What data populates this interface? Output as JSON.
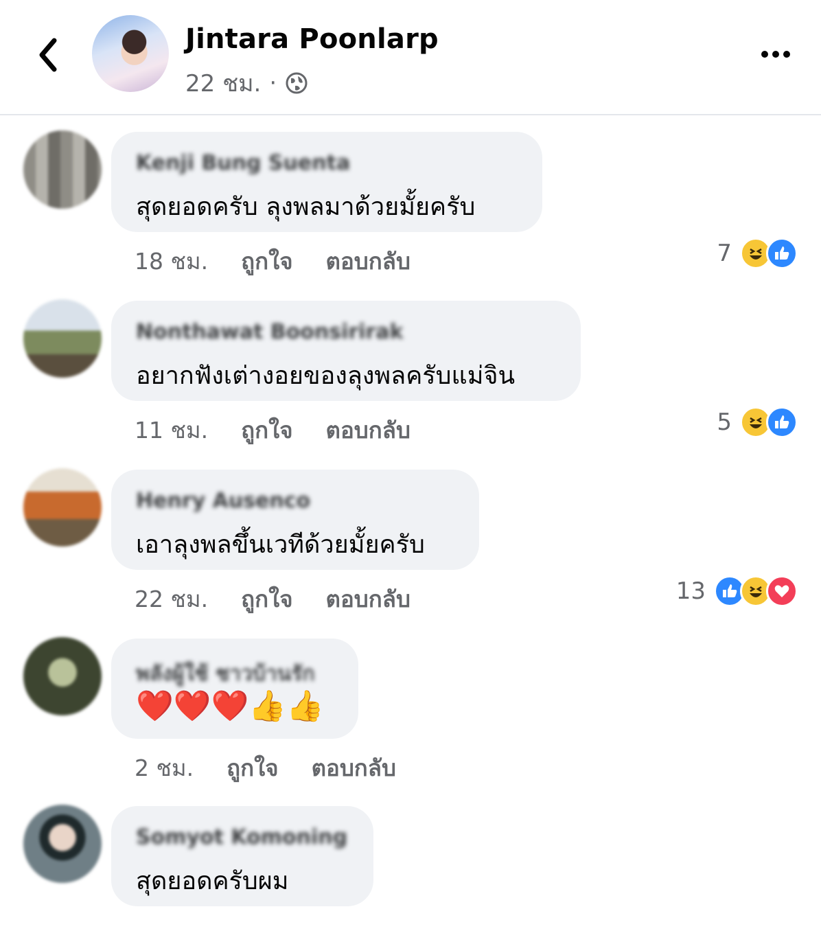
{
  "header": {
    "name": "Jintara Poonlarp",
    "time": "22 ชม.",
    "separator": "·"
  },
  "comments": [
    {
      "author": "Kenji Bung Suenta",
      "text": "สุดยอดครับ ลุงพลมาด้วยมั้ยครับ",
      "time": "18 ชม.",
      "like_label": "ถูกใจ",
      "reply_label": "ตอบกลับ",
      "reaction_count": "7",
      "reactions": [
        "haha",
        "like"
      ]
    },
    {
      "author": "Nonthawat Boonsirirak",
      "text": "อยากฟังเต่างอยของลุงพลครับแม่จิน",
      "time": "11 ชม.",
      "like_label": "ถูกใจ",
      "reply_label": "ตอบกลับ",
      "reaction_count": "5",
      "reactions": [
        "haha",
        "like"
      ]
    },
    {
      "author": "Henry Ausenco",
      "text": "เอาลุงพลขึ้นเวทีด้วยมั้ยครับ",
      "time": "22 ชม.",
      "like_label": "ถูกใจ",
      "reply_label": "ตอบกลับ",
      "reaction_count": "13",
      "reactions": [
        "like",
        "haha",
        "love"
      ]
    },
    {
      "author": "พลังผู้ใช้ ชาวบ้านรัก",
      "text": "❤️❤️❤️👍👍",
      "time": "2 ชม.",
      "like_label": "ถูกใจ",
      "reply_label": "ตอบกลับ",
      "reaction_count": "",
      "reactions": []
    },
    {
      "author": "Somyot Komoning",
      "text": "สุดยอดครับผม",
      "time": "",
      "like_label": "",
      "reply_label": "",
      "reaction_count": "",
      "reactions": []
    }
  ],
  "colors": {
    "like": "#2d88ff",
    "haha": "#f7c636",
    "love": "#f33e58",
    "bubble": "#f0f2f5",
    "meta": "#65676b"
  },
  "icons": {
    "back": "chevron-left-icon",
    "privacy": "globe-icon",
    "more": "more-horizontal-icon"
  }
}
